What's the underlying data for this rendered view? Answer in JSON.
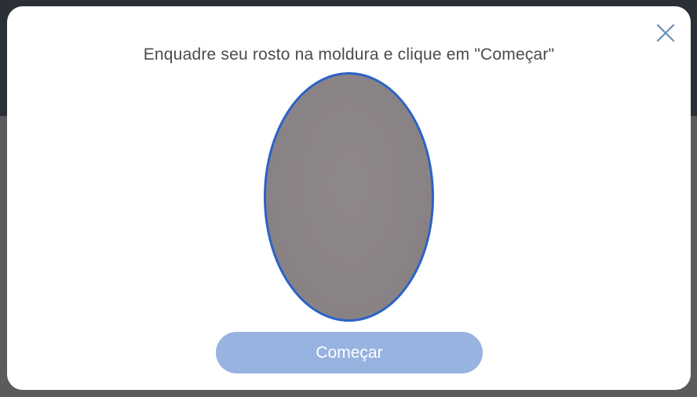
{
  "modal": {
    "instruction": "Enquadre seu rosto na moldura e clique em \"Começar\"",
    "start_button_label": "Começar",
    "close_icon": "close-icon"
  },
  "colors": {
    "frame_border": "#2a63c6",
    "button_bg": "#98b3e0",
    "close_icon": "#6b8fb3"
  }
}
